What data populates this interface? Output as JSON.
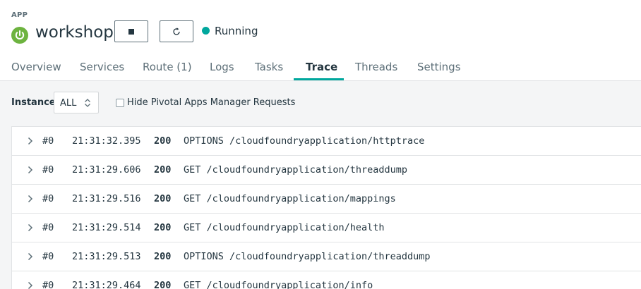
{
  "app": {
    "section_label": "APP",
    "name": "workshop",
    "logo_icon": "power-icon",
    "brand_color": "#6db33f"
  },
  "controls": {
    "stop_icon": "stop-icon",
    "restart_icon": "restart-icon"
  },
  "status": {
    "text": "Running",
    "color": "#00a79d"
  },
  "tabs": [
    {
      "label": "Overview",
      "active": false
    },
    {
      "label": "Services",
      "active": false
    },
    {
      "label": "Route (1)",
      "active": false
    },
    {
      "label": "Logs",
      "active": false
    },
    {
      "label": "Tasks",
      "active": false
    },
    {
      "label": "Trace",
      "active": true
    },
    {
      "label": "Threads",
      "active": false
    },
    {
      "label": "Settings",
      "active": false
    }
  ],
  "toolbar": {
    "instance_label": "Instance",
    "instance_value": "ALL",
    "hide_requests_label": "Hide Pivotal Apps Manager Requests",
    "hide_requests_checked": false
  },
  "traces": [
    {
      "id": "#0",
      "time": "21:31:32.395",
      "status": "200",
      "request": "OPTIONS /cloudfoundryapplication/httptrace"
    },
    {
      "id": "#0",
      "time": "21:31:29.606",
      "status": "200",
      "request": "GET /cloudfoundryapplication/threaddump"
    },
    {
      "id": "#0",
      "time": "21:31:29.516",
      "status": "200",
      "request": "GET /cloudfoundryapplication/mappings"
    },
    {
      "id": "#0",
      "time": "21:31:29.514",
      "status": "200",
      "request": "GET /cloudfoundryapplication/health"
    },
    {
      "id": "#0",
      "time": "21:31:29.513",
      "status": "200",
      "request": "OPTIONS /cloudfoundryapplication/threaddump"
    },
    {
      "id": "#0",
      "time": "21:31:29.464",
      "status": "200",
      "request": "GET /cloudfoundryapplication/info"
    }
  ]
}
